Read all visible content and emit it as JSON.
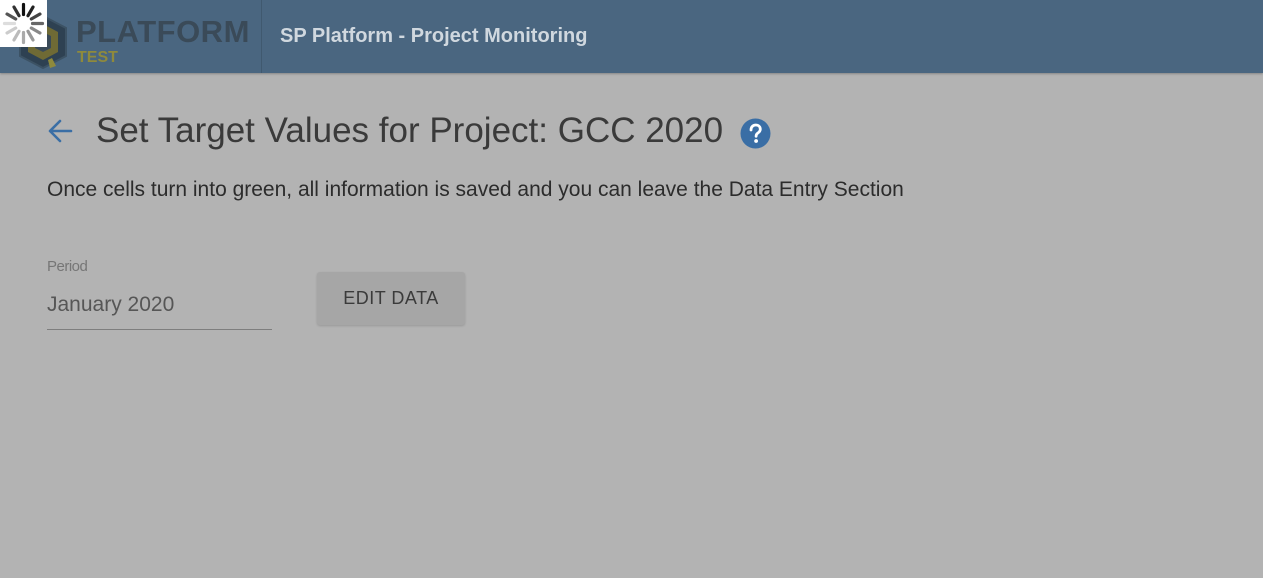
{
  "header": {
    "logo_text": "PLATFORM",
    "logo_subtext": "TEST",
    "app_title": "SP Platform - Project Monitoring"
  },
  "page": {
    "title": "Set Target Values for Project: GCC 2020",
    "info": "Once cells turn into green, all information is saved and you can leave the Data Entry Section"
  },
  "form": {
    "period_label": "Period",
    "period_value": "January 2020",
    "edit_button_label": "EDIT DATA"
  },
  "icons": {
    "back": "arrow-left-icon",
    "help": "help-circle-icon",
    "loading": "loading-spinner-icon",
    "logo": "platform-logo-icon"
  },
  "colors": {
    "app_bar": "#4a6680",
    "overlay_background": "#b3b3b3",
    "accent_blue": "#3a6ea5",
    "logo_subtext": "#8f8a3c"
  }
}
